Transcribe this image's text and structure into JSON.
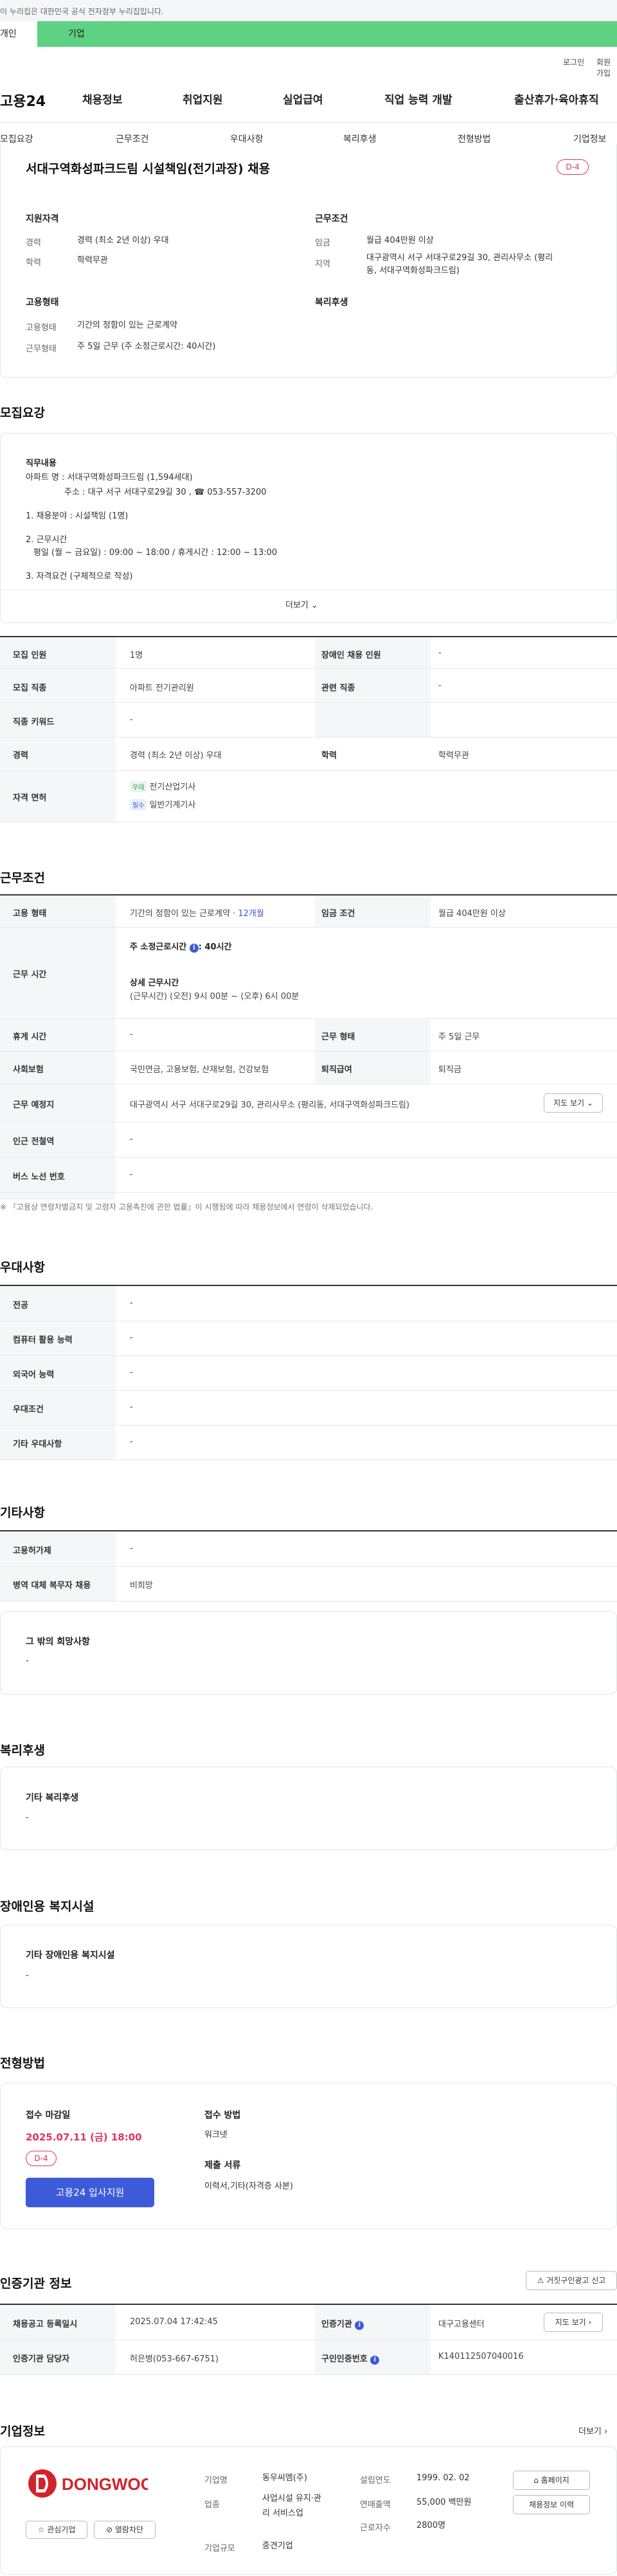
{
  "gov_banner": "이 누리집은 대한민국 공식 전자정부 누리집입니다.",
  "tabs": {
    "individual": "개인",
    "company": "기업"
  },
  "util": {
    "login": "로그인",
    "join": "회원가입"
  },
  "logo": "고용24",
  "gnb": [
    "채용정보",
    "취업지원",
    "실업급여",
    "직업 능력 개발",
    "출산휴가·육아휴직"
  ],
  "snb": [
    "모집요강",
    "근무조건",
    "우대사항",
    "복리후생",
    "전형방법",
    "기업정보"
  ],
  "job": {
    "title": "서대구역화성파크드림 시설책임(전기과장) 채용",
    "dday": "D-4",
    "qual_h": "지원자격",
    "career_l": "경력",
    "career_v": "경력 (최소 2년 이상) 우대",
    "edu_l": "학력",
    "edu_v": "학력무관",
    "cond_h": "근무조건",
    "wage_l": "임금",
    "wage_v": "월급 404만원 이상",
    "region_l": "지역",
    "region_v1": "대구광역시 서구 서대구로29길 30, 관리사무소 (평리",
    "region_v2": "동, 서대구역화성파크드림)",
    "emp_h": "고용형태",
    "emp_l": "고용형태",
    "emp_v": "기간의 정함이 있는 근로계약",
    "wtype_l": "근무형태",
    "wtype_v": "주 5일 근무 (주 소정근로시간: 40시간)",
    "welfare_h": "복리후생"
  },
  "recruit": {
    "heading": "모집요강",
    "duty_h": "직무내용",
    "lines": [
      "아파트 명 : 서대구역화성파크드림 (1,594세대)",
      "주소 : 대구 서구 서대구로29길 30 , ☎ 053-557-3200",
      "1. 채용분야 : 시설책임 (1명)",
      "2. 근무시간",
      "평일 (월 ~ 금요일) : 09:00 ~ 18:00 / 휴게시간 : 12:00 ~ 13:00",
      "3. 자격요건 (구체적으로 작성)"
    ],
    "more": "더보기",
    "rows": [
      {
        "k1": "모집 인원",
        "v1": "1명",
        "k2": "장애인 채용 인원",
        "v2": "-"
      },
      {
        "k1": "모집 직종",
        "v1": "아파트 전기관리원",
        "k2": "관련 직종",
        "v2": "-"
      },
      {
        "k1": "직종 키워드",
        "v1": "-"
      },
      {
        "k1": "경력",
        "v1": "경력 (최소 2년 이상) 우대",
        "k2": "학력",
        "v2": "학력무관"
      }
    ],
    "license_l": "자격 면허",
    "licenses": [
      {
        "tag": "우대",
        "name": "전기산업기사"
      },
      {
        "tag": "필수",
        "name": "일반기계기사"
      }
    ]
  },
  "conditions": {
    "heading": "근무조건",
    "emp_l": "고용 형태",
    "emp_v": "기간의 정함이 있는 근로계약 · ",
    "emp_months": "12개월",
    "wage_l": "임금 조건",
    "wage_v": "월급 404만원 이상",
    "time_l": "근무 시간",
    "time_main": "주 소정근로시간",
    "time_hours": ": 40시간",
    "time_detail_h": "상세 근무시간",
    "time_detail": "(근무시간) (오전) 9시 00분 ~ (오후) 6시 00분",
    "rest_l": "휴게 시간",
    "rest_v": "-",
    "form_l": "근무 형태",
    "form_v": "주 5일 근무",
    "ins_l": "사회보험",
    "ins_v": "국민연금, 고용보험, 산재보험, 건강보험",
    "ret_l": "퇴직급여",
    "ret_v": "퇴직금",
    "place_l": "근무 예정지",
    "place_v": "대구광역시 서구 서대구로29길 30, 관리사무소 (평리동, 서대구역화성파크드림)",
    "map_btn": "지도 보기",
    "station_l": "인근 전철역",
    "station_v": "-",
    "bus_l": "버스 노선 번호",
    "bus_v": "-",
    "notice": "※ 『고용상 연령차별금지 및 고령자 고용촉진에 관한 법률』이 시행됨에 따라 채용정보에서 연령이 삭제되었습니다."
  },
  "preference": {
    "heading": "우대사항",
    "rows": [
      {
        "k": "전공",
        "v": "-"
      },
      {
        "k": "컴퓨터 활용 능력",
        "v": "-"
      },
      {
        "k": "외국어 능력",
        "v": "-"
      },
      {
        "k": "우대조건",
        "v": "-"
      },
      {
        "k": "기타 우대사항",
        "v": "-"
      }
    ]
  },
  "other": {
    "heading": "기타사항",
    "rows": [
      {
        "k": "고용허가제",
        "v": "-"
      },
      {
        "k": "병역 대체 복무자 채용",
        "v": "비희망"
      }
    ],
    "wish_h": "그 밖의 희망사항",
    "wish_v": "-"
  },
  "welfare": {
    "heading": "복리후생",
    "sub": "기타 복리후생",
    "val": "-"
  },
  "disabled": {
    "heading": "장애인용 복지시설",
    "sub": "기타 장애인용 복지시설",
    "val": "-"
  },
  "selection": {
    "heading": "전형방법",
    "deadline_h": "접수 마감일",
    "deadline_v": "2025.07.11 (금) 18:00",
    "dday": "D-4",
    "apply_btn": "고용24 입사지원",
    "method_h": "접수 방법",
    "method_v": "워크넷",
    "docs_h": "제출 서류",
    "docs_v": "이력서,기타(자격증 사본)"
  },
  "cert": {
    "heading": "인증기관 정보",
    "report_btn": "거짓구인광고 신고",
    "reg_l": "채용공고 등록일시",
    "reg_v": "2025.07.04 17:42:45",
    "org_l": "인증기관",
    "org_v": "대구고용센터",
    "dir_btn": "지도 보기",
    "mgr_l": "인증기관 담당자",
    "mgr_v": "허은병(053-667-6751)",
    "auth_l": "구인인증번호",
    "auth_v": "K140112507040016"
  },
  "company": {
    "heading": "기업정보",
    "more": "더보기",
    "logo_text": "DONGWOO",
    "interest_btn": "관심기업",
    "block_btn": "열람차단",
    "name_l": "기업명",
    "name_v": "동우씨엠(주)",
    "biz_l": "업종",
    "biz_v1": "사업시설 유지·관",
    "biz_v2": "리 서비스업",
    "size_l": "기업규모",
    "size_v": "중견기업",
    "year_l": "설립연도",
    "year_v": "1999. 02. 02",
    "sales_l": "연매출액",
    "sales_v": "55,000 백만원",
    "emp_l": "근로자수",
    "emp_v": "2800명",
    "home_btn": "홈페이지",
    "jobs_btn": "채용정보 이력"
  },
  "colors": {
    "accent_green": "#5ed183",
    "accent_blue": "#3d5bd9",
    "dday_red": "#e2335f"
  }
}
